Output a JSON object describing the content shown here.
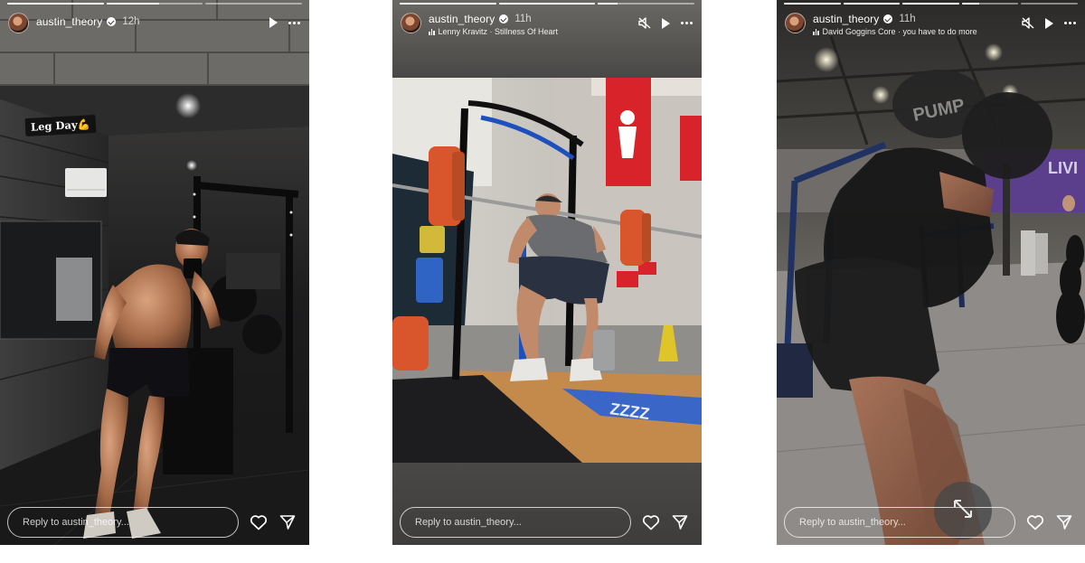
{
  "stories": [
    {
      "username": "austin_theory",
      "time": "12h",
      "sticker": "Leg Day💪",
      "reply_placeholder": "Reply to austin_theory...",
      "progress": [
        1,
        0.55,
        0
      ],
      "icons": [
        "play-icon",
        "more-icon",
        "heart-icon",
        "send-icon"
      ]
    },
    {
      "username": "austin_theory",
      "time": "11h",
      "music": "Lenny Kravitz · Stillness Of Heart",
      "reply_placeholder": "Reply to austin_theory...",
      "progress": [
        1,
        1,
        0.2
      ],
      "icons": [
        "mute-icon",
        "play-icon",
        "more-icon",
        "heart-icon",
        "send-icon"
      ]
    },
    {
      "username": "austin_theory",
      "time": "11h",
      "music": "David Goggins Core · you have to do more",
      "reply_placeholder": "Reply to austin_theory...",
      "progress": [
        1,
        1,
        1,
        0.3,
        0
      ],
      "icons": [
        "mute-icon",
        "play-icon",
        "more-icon",
        "heart-icon",
        "send-icon",
        "expand-icon"
      ]
    }
  ],
  "colors": {
    "story2_background": "#4a4846",
    "sign_red": "#d8232a",
    "plate_orange": "#d9552b",
    "floor_wood": "#c48a4b"
  }
}
